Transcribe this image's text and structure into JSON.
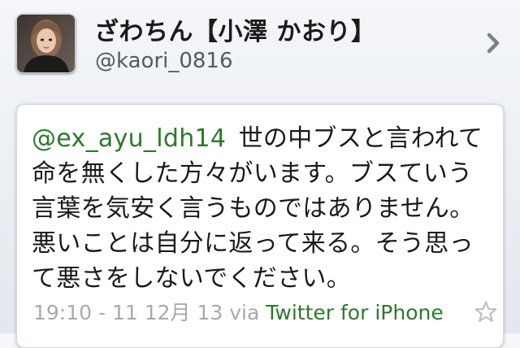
{
  "profile": {
    "display_name": "ざわちん【小澤 かおり】",
    "handle": "@kaori_0816"
  },
  "tweet": {
    "mention": "@ex_ayu_ldh14",
    "body": "世の中ブスと言われて命を無くした方々がいます。ブスていう言葉を気安く言うものではありません。悪いことは自分に返って来る。そう思って悪さをしないでください。",
    "timestamp": "19:10 - 11 12月 13",
    "via_label": "via",
    "client": "Twitter for iPhone"
  },
  "icons": {
    "detail": "chevron-right-icon",
    "favorite": "star-icon"
  },
  "colors": {
    "mention": "#2d7a2d",
    "meta": "#a6aab0"
  }
}
